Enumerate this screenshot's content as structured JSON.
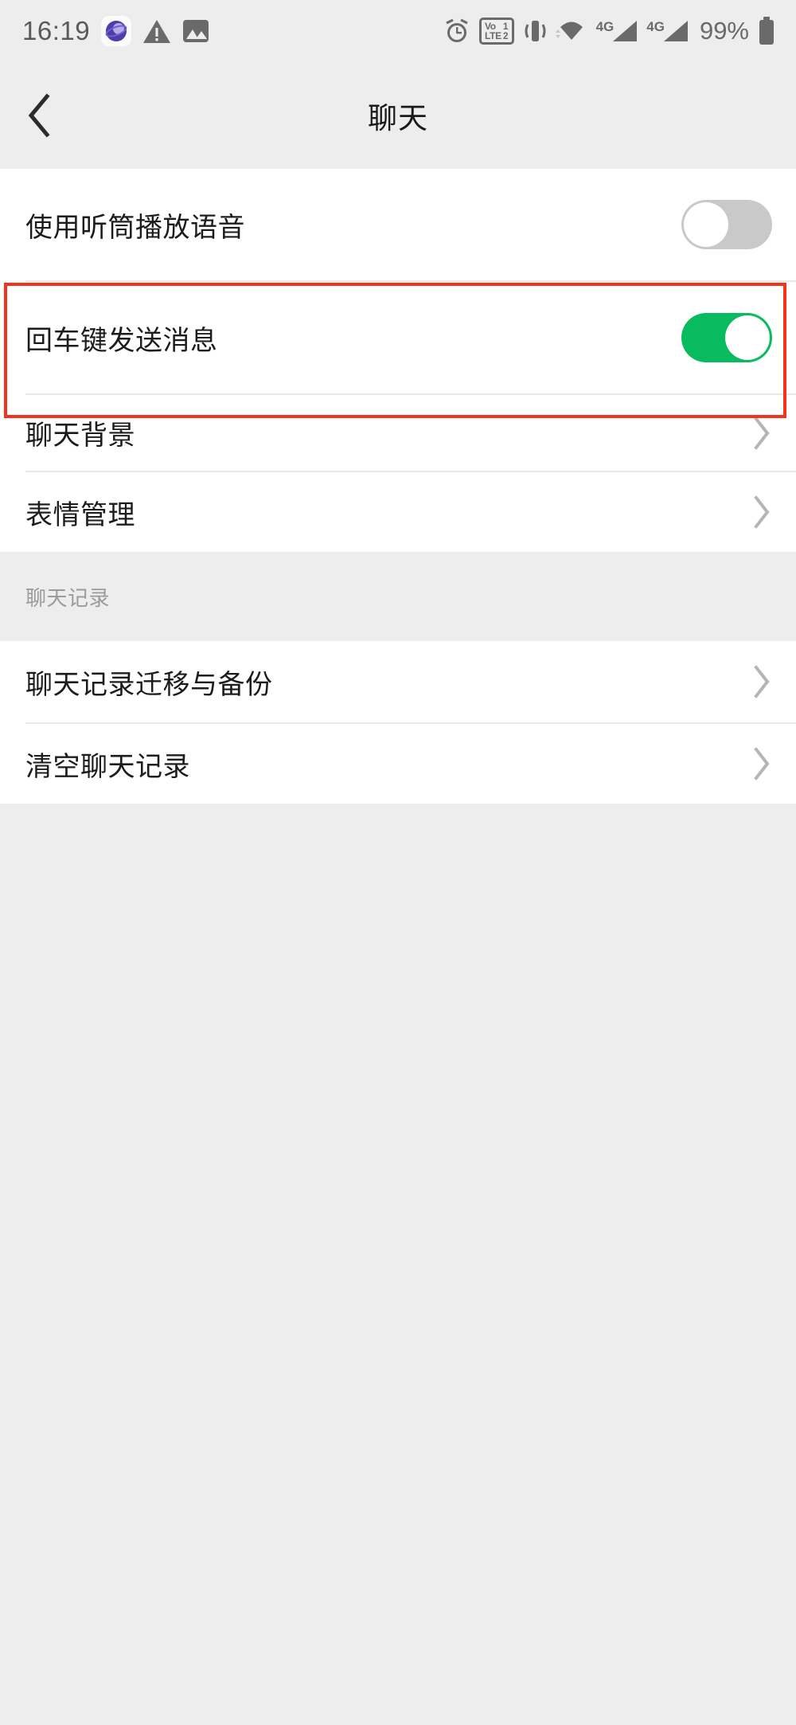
{
  "status_bar": {
    "time": "16:19",
    "battery_percent": "99%",
    "left_icons": [
      "app-badge-icon",
      "warning-triangle-icon",
      "image-icon"
    ],
    "right_icons": [
      "alarm-clock-icon",
      "volte-dual-sim-icon",
      "vibrate-icon",
      "wifi-icon",
      "signal-4g-1-icon",
      "signal-4g-2-icon",
      "battery-icon"
    ],
    "volte": {
      "line1": "Vo",
      "line2": "LTE",
      "sim1": "1",
      "sim2": "2"
    },
    "network_label_1": "4G",
    "network_label_2": "4G"
  },
  "nav": {
    "title": "聊天",
    "back_icon": "chevron-left-icon"
  },
  "settings": {
    "group1": [
      {
        "label": "使用听筒播放语音",
        "control": "switch",
        "value": "off"
      },
      {
        "label": "回车键发送消息",
        "control": "switch",
        "value": "on",
        "highlighted": "true"
      },
      {
        "label": "聊天背景",
        "control": "chevron"
      },
      {
        "label": "表情管理",
        "control": "chevron"
      }
    ],
    "section2_header": "聊天记录",
    "group2": [
      {
        "label": "聊天记录迁移与备份",
        "control": "chevron"
      },
      {
        "label": "清空聊天记录",
        "control": "chevron"
      }
    ]
  },
  "colors": {
    "switch_on": "#09bb5f",
    "switch_off": "#c9c9c9",
    "highlight": "#f4321e",
    "page_bg": "#ededed",
    "row_bg": "#ffffff",
    "text": "#1c1c1c",
    "muted_text": "#9b9b9b",
    "chevron": "#b5b5b5"
  }
}
